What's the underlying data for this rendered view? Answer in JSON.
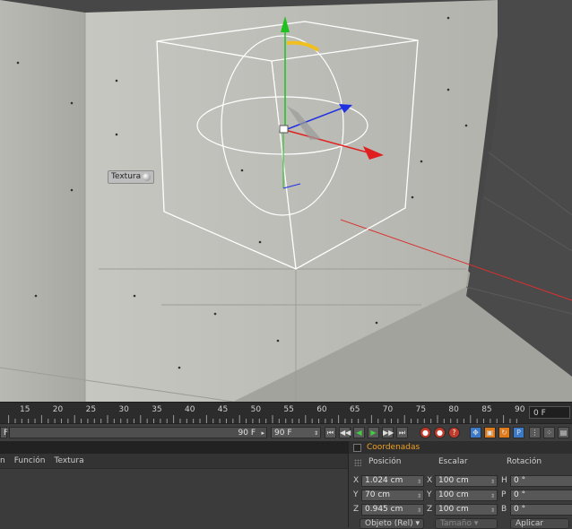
{
  "viewport": {
    "texture_tag": "Textura",
    "bg_color": "#474747",
    "axis_colors": {
      "x": "#e02020",
      "y": "#20c020",
      "z": "#2030e0"
    }
  },
  "timeline": {
    "ticks": [
      "15",
      "20",
      "25",
      "30",
      "35",
      "40",
      "45",
      "50",
      "55",
      "60",
      "65",
      "70",
      "75",
      "80",
      "85",
      "90"
    ],
    "current_frame": "0 F"
  },
  "transport": {
    "start_value": "F",
    "end_field": "90 F",
    "end_field2": "90 F"
  },
  "lower_left": {
    "menu": [
      "n",
      "Función",
      "Textura"
    ]
  },
  "coordinates": {
    "title": "Coordenadas",
    "col_position": "Posición",
    "col_scale": "Escalar",
    "col_rotation": "Rotación",
    "rows": [
      {
        "pos_axis": "X",
        "pos": "1.024 cm",
        "scale_axis": "X",
        "scale": "100 cm",
        "rot_axis": "H",
        "rot": "0 °"
      },
      {
        "pos_axis": "Y",
        "pos": "70 cm",
        "scale_axis": "Y",
        "scale": "100 cm",
        "rot_axis": "P",
        "rot": "0 °"
      },
      {
        "pos_axis": "Z",
        "pos": "0.945 cm",
        "scale_axis": "Z",
        "scale": "100 cm",
        "rot_axis": "B",
        "rot": "0 °"
      }
    ],
    "mode_dropdown": "Objeto (Rel)",
    "size_dropdown": "Tamaño",
    "apply_button": "Aplicar"
  }
}
